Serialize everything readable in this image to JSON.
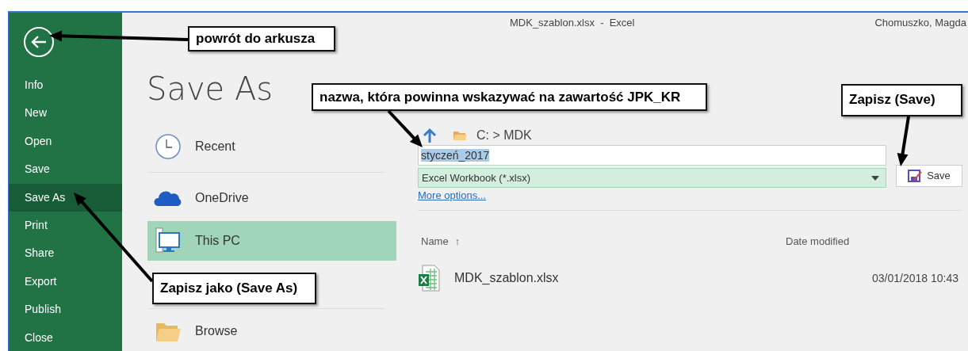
{
  "window": {
    "title": "MDK_szablon.xlsx  -  Excel",
    "user": "Chomuszko, Magda"
  },
  "sidebar": {
    "items": [
      {
        "label": "Info",
        "selected": false
      },
      {
        "label": "New",
        "selected": false
      },
      {
        "label": "Open",
        "selected": false
      },
      {
        "label": "Save",
        "selected": false
      },
      {
        "label": "Save As",
        "selected": true
      },
      {
        "label": "Print",
        "selected": false
      },
      {
        "label": "Share",
        "selected": false
      },
      {
        "label": "Export",
        "selected": false
      },
      {
        "label": "Publish",
        "selected": false
      },
      {
        "label": "Close",
        "selected": false
      }
    ]
  },
  "heading": "Save As",
  "locations": [
    {
      "kind": "recent",
      "label": "Recent",
      "selected": false
    },
    {
      "kind": "cloud",
      "label": "OneDrive",
      "selected": false
    },
    {
      "kind": "pc",
      "label": "This PC",
      "selected": true
    },
    {
      "kind": "browse",
      "label": "Browse",
      "selected": false
    }
  ],
  "path": "C: > MDK",
  "file_name": "styczeń_2017",
  "file_type": "Excel Workbook (*.xlsx)",
  "more_options": "More options...",
  "save_button": "Save",
  "files": {
    "columns": [
      {
        "label": "Name",
        "sort": "↑"
      },
      {
        "label": "Date modified"
      }
    ],
    "rows": [
      {
        "name": "MDK_szablon.xlsx",
        "date": "03/01/2018 10:43"
      }
    ]
  },
  "callouts": [
    "powrót do arkusza",
    "nazwa, która powinna wskazywać na zawartość JPK_KR",
    "Zapisz (Save)",
    "Zapisz jako (Save As)"
  ]
}
